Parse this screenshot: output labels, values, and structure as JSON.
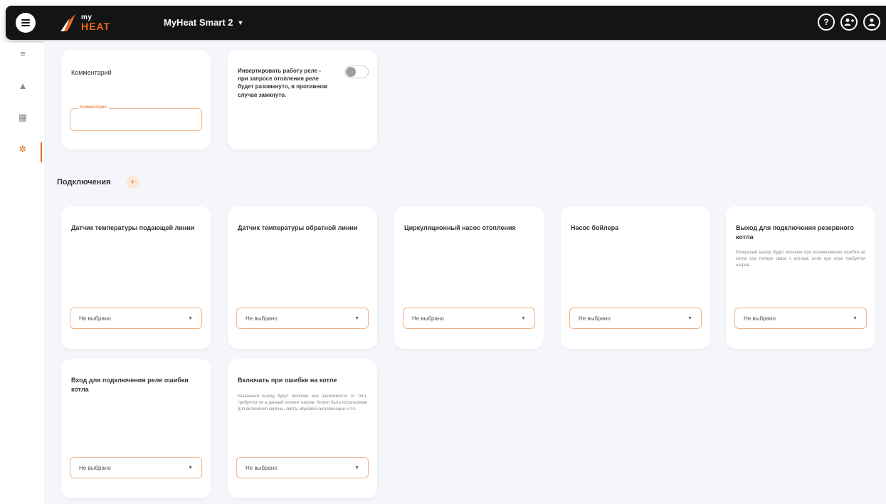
{
  "header": {
    "logo_top": "my",
    "logo_bottom": "HEAT",
    "device_name": "MyHeat Smart 2",
    "help_label": "?"
  },
  "colors": {
    "accent": "#e86b1f",
    "header_bg": "#141414",
    "content_bg": "#f4f6fb"
  },
  "sidebar": {
    "items": [
      {
        "icon": "list-icon",
        "glyph": "≡"
      },
      {
        "icon": "warning-icon",
        "glyph": "▲"
      },
      {
        "icon": "calendar-icon",
        "glyph": "▦"
      },
      {
        "icon": "gear-icon",
        "glyph": "✲",
        "active": true
      }
    ]
  },
  "top_cards": {
    "comment": {
      "title": "Комментарий",
      "input_label": "Комментарий",
      "input_value": ""
    },
    "invert": {
      "text": "Инвертировать работу реле - при запросе отопления реле будет разомкнуто, в противном случае замкнуто.",
      "enabled": false
    }
  },
  "connections": {
    "title": "Подключения",
    "add_glyph": "+",
    "items": [
      {
        "title": "Датчик температуры подающей линии",
        "value": "Не выбрано"
      },
      {
        "title": "Датчик температуры обратной линии",
        "value": "Не выбрано"
      },
      {
        "title": "Циркуляционный насос отопления",
        "value": "Не выбрано"
      },
      {
        "title": "Насос бойлера",
        "value": "Не выбрано"
      },
      {
        "title": "Выход для подключения резервного котла",
        "description": "Резервный выход будет включен при возникновении ошибки на котле или потере связи с котлом, если при этом требуется нагрев.",
        "value": "Не выбрано"
      },
      {
        "title": "Вход для подключения реле ошибки котла",
        "value": "Не выбрано"
      },
      {
        "title": "Включать при ошибке на котле",
        "description": "Указанный выход будет включен вне зависимости от того, требуется ли в данный момент нагрев. Может быть использован для включения сирены, света, звуковой сигнализации и т.п.",
        "value": "Не выбрано"
      }
    ]
  }
}
